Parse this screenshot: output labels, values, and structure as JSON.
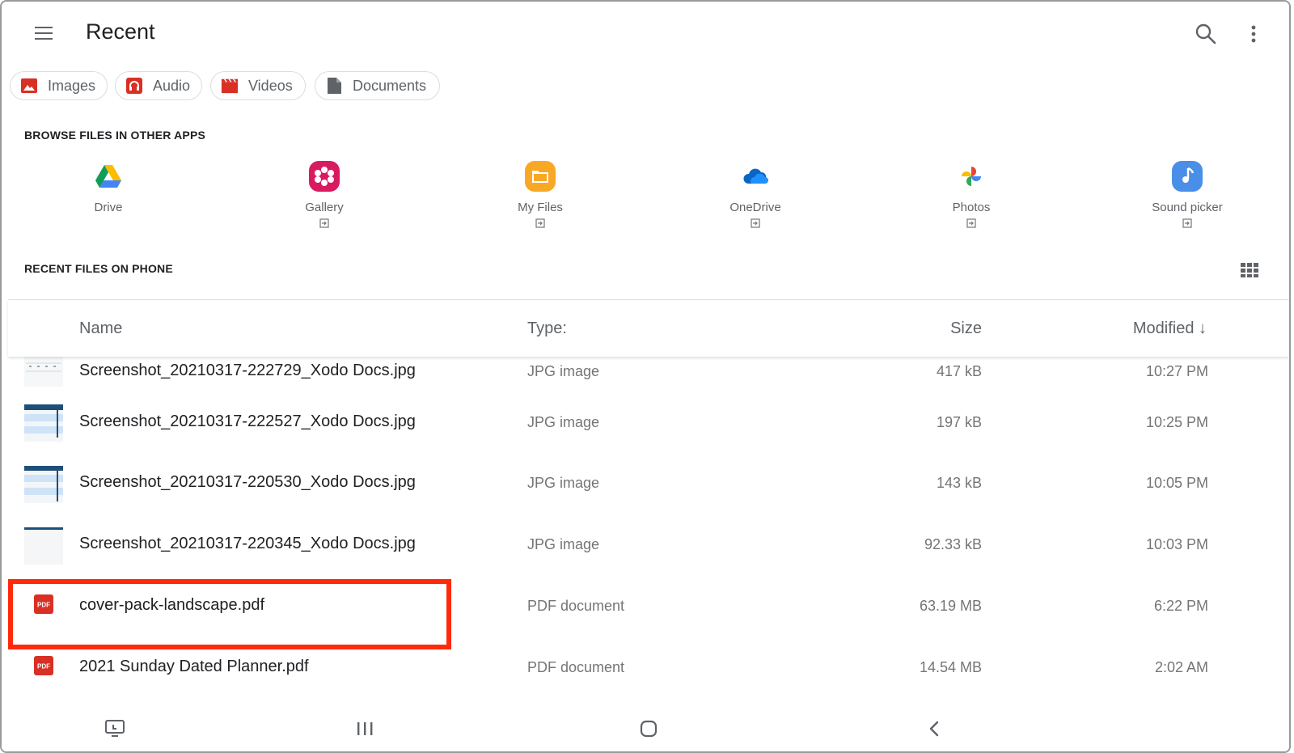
{
  "header": {
    "title": "Recent"
  },
  "chips": [
    {
      "label": "Images",
      "icon": "image-icon"
    },
    {
      "label": "Audio",
      "icon": "headphones-icon"
    },
    {
      "label": "Videos",
      "icon": "clapperboard-icon"
    },
    {
      "label": "Documents",
      "icon": "document-icon"
    }
  ],
  "sections": {
    "browse": "BROWSE FILES IN OTHER APPS",
    "recent": "RECENT FILES ON PHONE"
  },
  "apps": [
    {
      "name": "Drive",
      "icon": "drive-icon"
    },
    {
      "name": "Gallery",
      "icon": "gallery-icon"
    },
    {
      "name": "My Files",
      "icon": "my-files-icon"
    },
    {
      "name": "OneDrive",
      "icon": "onedrive-icon"
    },
    {
      "name": "Photos",
      "icon": "photos-icon"
    },
    {
      "name": "Sound picker",
      "icon": "sound-picker-icon"
    }
  ],
  "table": {
    "columns": {
      "name": "Name",
      "type": "Type:",
      "size": "Size",
      "modified": "Modified ↓"
    },
    "rows": [
      {
        "name": "Screenshot_20210317-222729_Xodo Docs.jpg",
        "type": "JPG image",
        "size": "417 kB",
        "modified": "10:27 PM",
        "thumb": "image-thumbnail"
      },
      {
        "name": "Screenshot_20210317-222527_Xodo Docs.jpg",
        "type": "JPG image",
        "size": "197 kB",
        "modified": "10:25 PM",
        "thumb": "image-thumbnail"
      },
      {
        "name": "Screenshot_20210317-220530_Xodo Docs.jpg",
        "type": "JPG image",
        "size": "143 kB",
        "modified": "10:05 PM",
        "thumb": "image-thumbnail"
      },
      {
        "name": "Screenshot_20210317-220345_Xodo Docs.jpg",
        "type": "JPG image",
        "size": "92.33 kB",
        "modified": "10:03 PM",
        "thumb": "image-thumbnail"
      },
      {
        "name": "cover-pack-landscape.pdf",
        "type": "PDF document",
        "size": "63.19 MB",
        "modified": "6:22 PM",
        "thumb": "pdf-icon"
      },
      {
        "name": "2021 Sunday Dated Planner.pdf",
        "type": "PDF document",
        "size": "14.54 MB",
        "modified": "2:02 AM",
        "thumb": "pdf-icon"
      }
    ]
  },
  "pdf_badge": "PDF",
  "colors": {
    "accent_red": "#d93025",
    "highlight_box": "#ff2a0a",
    "text_primary": "#202124",
    "text_secondary": "#5f6368"
  }
}
